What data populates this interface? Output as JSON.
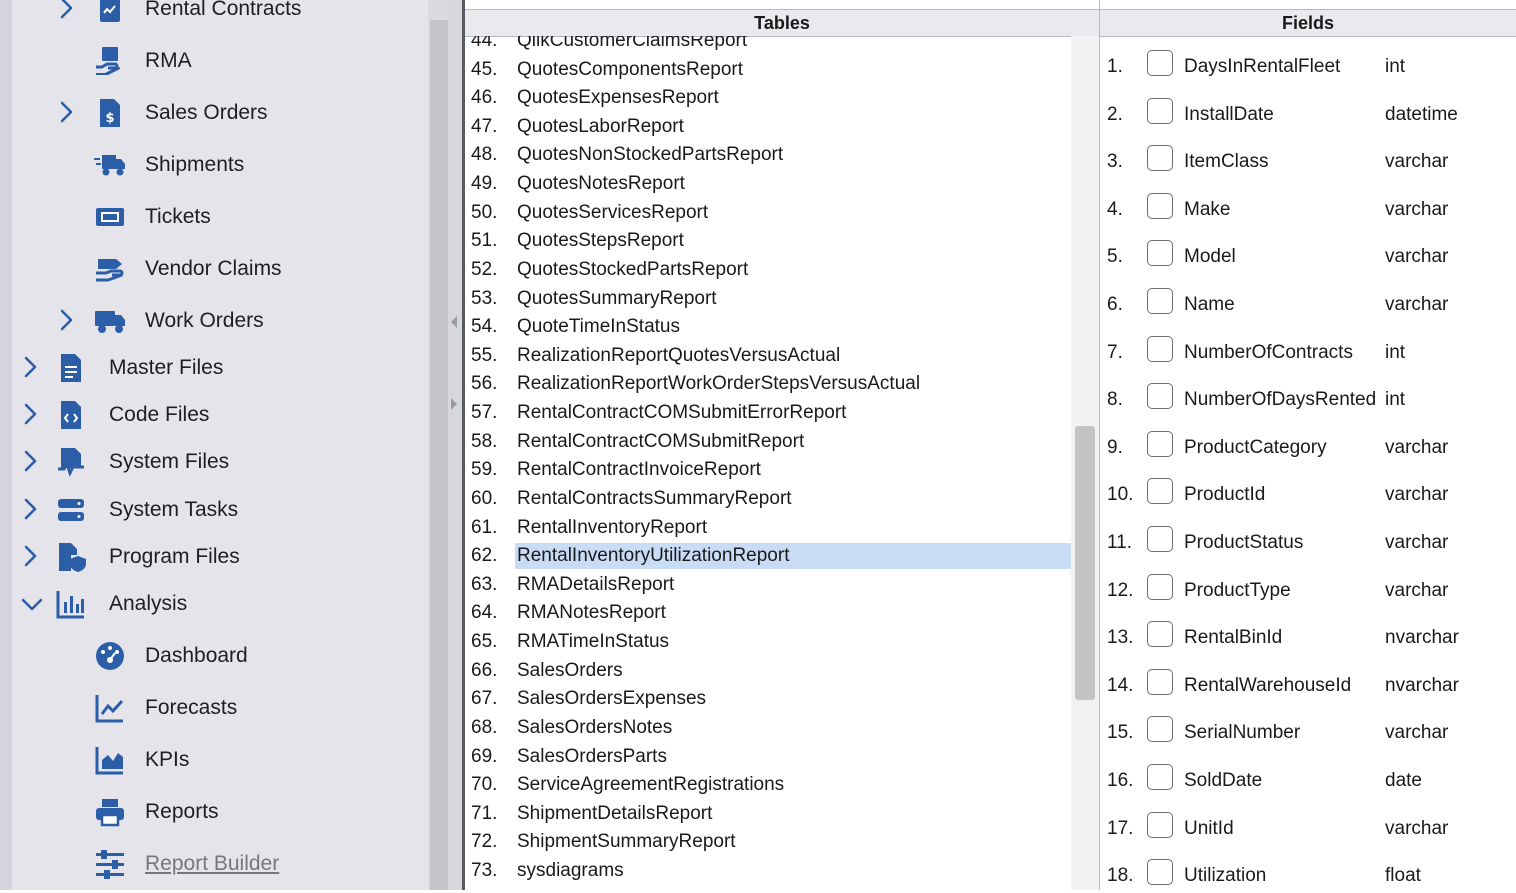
{
  "sidebar": {
    "items": [
      {
        "label": "Rental Contracts",
        "icon": "rental-contract-icon",
        "expandable": true
      },
      {
        "label": "RMA",
        "icon": "rma-icon",
        "expandable": false
      },
      {
        "label": "Sales Orders",
        "icon": "sales-order-icon",
        "expandable": true
      },
      {
        "label": "Shipments",
        "icon": "truck-fast-icon",
        "expandable": false
      },
      {
        "label": "Tickets",
        "icon": "ticket-icon",
        "expandable": false
      },
      {
        "label": "Vendor Claims",
        "icon": "hand-coin-icon",
        "expandable": false
      },
      {
        "label": "Work Orders",
        "icon": "truck-icon",
        "expandable": true
      },
      {
        "label": "Master Files",
        "icon": "file-lines-icon",
        "expandable": true
      },
      {
        "label": "Code Files",
        "icon": "file-code-icon",
        "expandable": true
      },
      {
        "label": "System Files",
        "icon": "file-pulse-icon",
        "expandable": true
      },
      {
        "label": "System Tasks",
        "icon": "server-icon",
        "expandable": true
      },
      {
        "label": "Program Files",
        "icon": "file-shield-icon",
        "expandable": true
      },
      {
        "label": "Analysis",
        "icon": "chart-bar-icon",
        "expandable": true,
        "expanded": true
      },
      {
        "label": "Dashboard",
        "icon": "gauge-icon",
        "expandable": false
      },
      {
        "label": "Forecasts",
        "icon": "chart-line-icon",
        "expandable": false
      },
      {
        "label": "KPIs",
        "icon": "chart-area-icon",
        "expandable": false
      },
      {
        "label": "Reports",
        "icon": "printer-icon",
        "expandable": false
      },
      {
        "label": "Report Builder",
        "icon": "sliders-icon",
        "expandable": false,
        "active": true
      }
    ]
  },
  "tables": {
    "header": "Tables",
    "items": [
      {
        "num": "44.",
        "name": "QlikCustomerClaimsReport"
      },
      {
        "num": "45.",
        "name": "QuotesComponentsReport"
      },
      {
        "num": "46.",
        "name": "QuotesExpensesReport"
      },
      {
        "num": "47.",
        "name": "QuotesLaborReport"
      },
      {
        "num": "48.",
        "name": "QuotesNonStockedPartsReport"
      },
      {
        "num": "49.",
        "name": "QuotesNotesReport"
      },
      {
        "num": "50.",
        "name": "QuotesServicesReport"
      },
      {
        "num": "51.",
        "name": "QuotesStepsReport"
      },
      {
        "num": "52.",
        "name": "QuotesStockedPartsReport"
      },
      {
        "num": "53.",
        "name": "QuotesSummaryReport"
      },
      {
        "num": "54.",
        "name": "QuoteTimeInStatus"
      },
      {
        "num": "55.",
        "name": "RealizationReportQuotesVersusActual"
      },
      {
        "num": "56.",
        "name": "RealizationReportWorkOrderStepsVersusActual"
      },
      {
        "num": "57.",
        "name": "RentalContractCOMSubmitErrorReport"
      },
      {
        "num": "58.",
        "name": "RentalContractCOMSubmitReport"
      },
      {
        "num": "59.",
        "name": "RentalContractInvoiceReport"
      },
      {
        "num": "60.",
        "name": "RentalContractsSummaryReport"
      },
      {
        "num": "61.",
        "name": "RentalInventoryReport"
      },
      {
        "num": "62.",
        "name": "RentalInventoryUtilizationReport",
        "selected": true
      },
      {
        "num": "63.",
        "name": "RMADetailsReport"
      },
      {
        "num": "64.",
        "name": "RMANotesReport"
      },
      {
        "num": "65.",
        "name": "RMATimeInStatus"
      },
      {
        "num": "66.",
        "name": "SalesOrders"
      },
      {
        "num": "67.",
        "name": "SalesOrdersExpenses"
      },
      {
        "num": "68.",
        "name": "SalesOrdersNotes"
      },
      {
        "num": "69.",
        "name": "SalesOrdersParts"
      },
      {
        "num": "70.",
        "name": "ServiceAgreementRegistrations"
      },
      {
        "num": "71.",
        "name": "ShipmentDetailsReport"
      },
      {
        "num": "72.",
        "name": "ShipmentSummaryReport"
      },
      {
        "num": "73.",
        "name": "sysdiagrams"
      }
    ]
  },
  "fields": {
    "header": "Fields",
    "items": [
      {
        "num": "1.",
        "name": "DaysInRentalFleet",
        "type": "int"
      },
      {
        "num": "2.",
        "name": "InstallDate",
        "type": "datetime"
      },
      {
        "num": "3.",
        "name": "ItemClass",
        "type": "varchar"
      },
      {
        "num": "4.",
        "name": "Make",
        "type": "varchar"
      },
      {
        "num": "5.",
        "name": "Model",
        "type": "varchar"
      },
      {
        "num": "6.",
        "name": "Name",
        "type": "varchar"
      },
      {
        "num": "7.",
        "name": "NumberOfContracts",
        "type": "int"
      },
      {
        "num": "8.",
        "name": "NumberOfDaysRented",
        "type": "int"
      },
      {
        "num": "9.",
        "name": "ProductCategory",
        "type": "varchar"
      },
      {
        "num": "10.",
        "name": "ProductId",
        "type": "varchar"
      },
      {
        "num": "11.",
        "name": "ProductStatus",
        "type": "varchar"
      },
      {
        "num": "12.",
        "name": "ProductType",
        "type": "varchar"
      },
      {
        "num": "13.",
        "name": "RentalBinId",
        "type": "nvarchar"
      },
      {
        "num": "14.",
        "name": "RentalWarehouseId",
        "type": "nvarchar"
      },
      {
        "num": "15.",
        "name": "SerialNumber",
        "type": "varchar"
      },
      {
        "num": "16.",
        "name": "SoldDate",
        "type": "date"
      },
      {
        "num": "17.",
        "name": "UnitId",
        "type": "varchar"
      },
      {
        "num": "18.",
        "name": "Utilization",
        "type": "float"
      }
    ]
  },
  "colors": {
    "accent": "#2c5ea8",
    "sidebar_bg": "#e4e4ea",
    "selection": "#c9dcf6"
  }
}
